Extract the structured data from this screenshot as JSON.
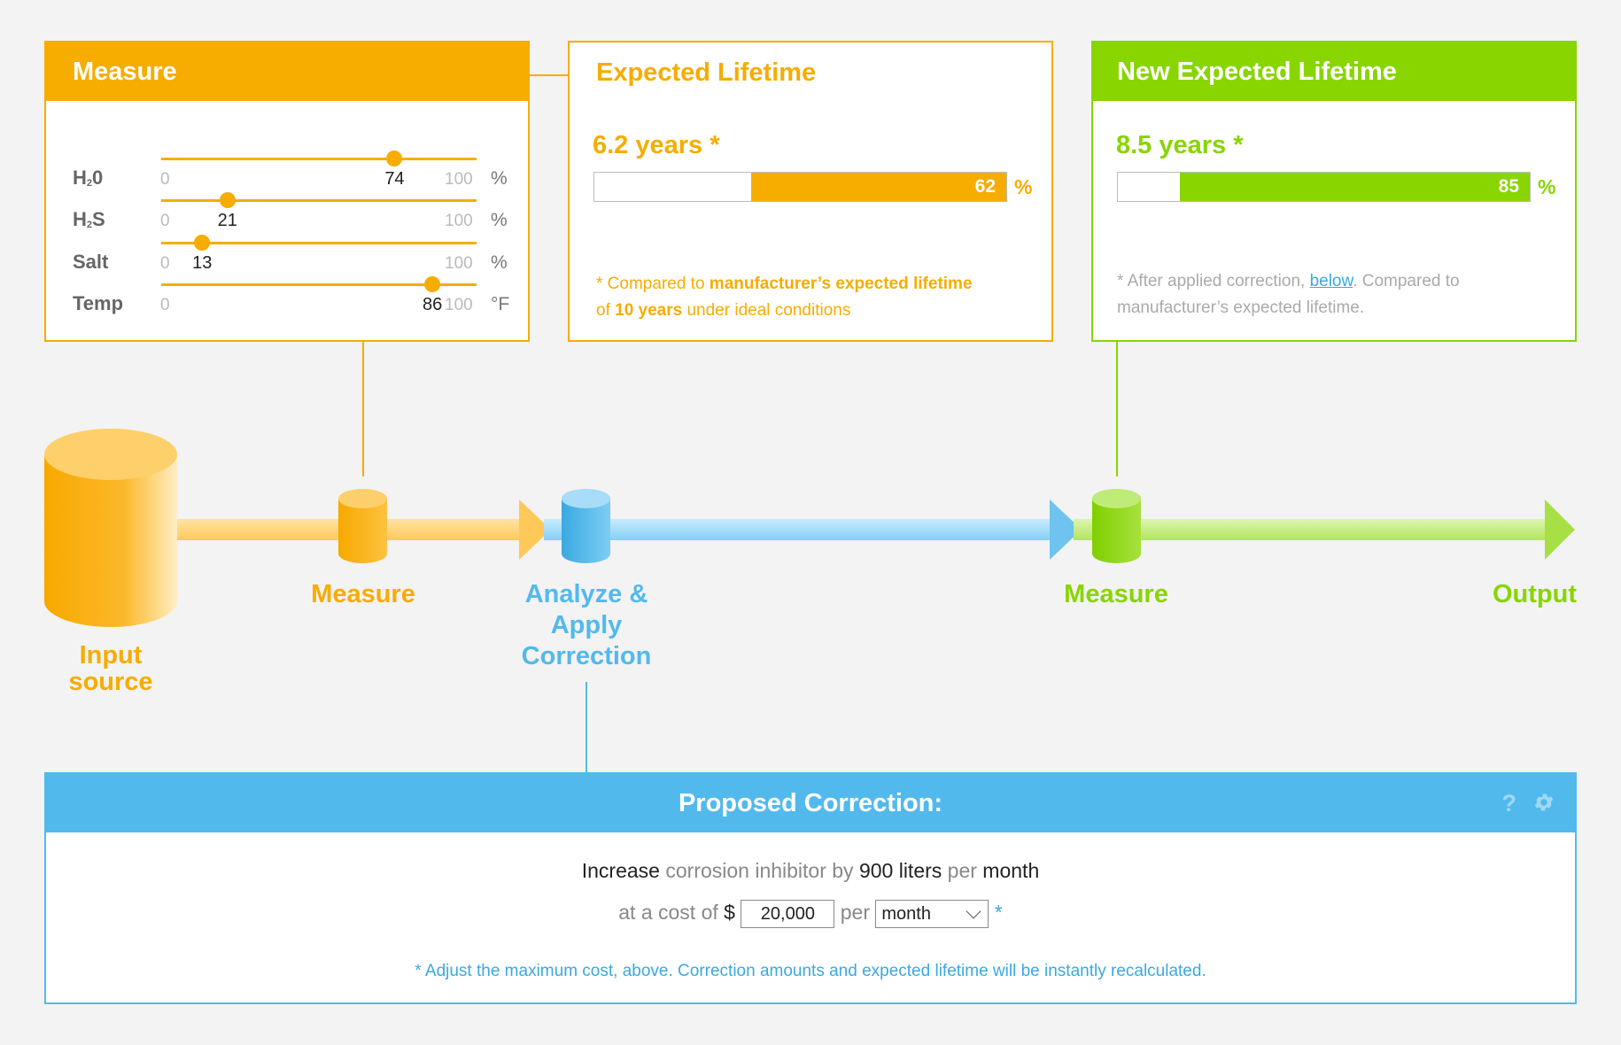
{
  "colors": {
    "orange": "#f7ac00",
    "blue": "#52b9ed",
    "green": "#88d500"
  },
  "measure": {
    "title": "Measure",
    "params": [
      {
        "label_main": "H",
        "label_sub": "2",
        "label_tail": "0",
        "min": "0",
        "max": "100",
        "value": "74",
        "unit": "%"
      },
      {
        "label_main": "H",
        "label_sub": "2",
        "label_tail": "S",
        "min": "0",
        "max": "100",
        "value": "21",
        "unit": "%"
      },
      {
        "label_main": "Salt",
        "label_sub": "",
        "label_tail": "",
        "min": "0",
        "max": "100",
        "value": "13",
        "unit": "%"
      },
      {
        "label_main": "Temp",
        "label_sub": "",
        "label_tail": "",
        "min": "0",
        "max": "100",
        "value": "86",
        "unit": "°F"
      }
    ]
  },
  "expected": {
    "title": "Expected Lifetime",
    "years": "6.2 years *",
    "percent": "62",
    "pct_symbol": "%",
    "note_1": "* Compared to ",
    "note_bold_1": "manufacturer’s expected lifetime",
    "note_2": "of ",
    "note_bold_2": "10 years",
    "note_3": " under ideal conditions"
  },
  "new_expected": {
    "title": "New Expected Lifetime",
    "years": "8.5 years *",
    "percent": "85",
    "pct_symbol": "%",
    "note_1": "* After applied correction, ",
    "note_link": "below",
    "note_2": ". Compared to manufacturer’s expected lifetime."
  },
  "pipeline": {
    "input_label": "Input source",
    "measure_label": "Measure",
    "analyze_label": "Analyze & Apply Correction",
    "measure2_label": "Measure",
    "output_label": "Output"
  },
  "correction": {
    "title": "Proposed Correction:",
    "help": "?",
    "increase": "Increase",
    "what": " corrosion inhibitor ",
    "by": "by",
    "amount": " 900 liters ",
    "per": "per",
    "period": " month",
    "cost_prefix": "at a cost of ",
    "dollar": "$",
    "cost_value": "20,000",
    "per2": " per ",
    "period_select": "month",
    "asterisk": " *",
    "note": "* Adjust the maximum cost, above. Correction amounts and expected lifetime will be instantly recalculated."
  }
}
